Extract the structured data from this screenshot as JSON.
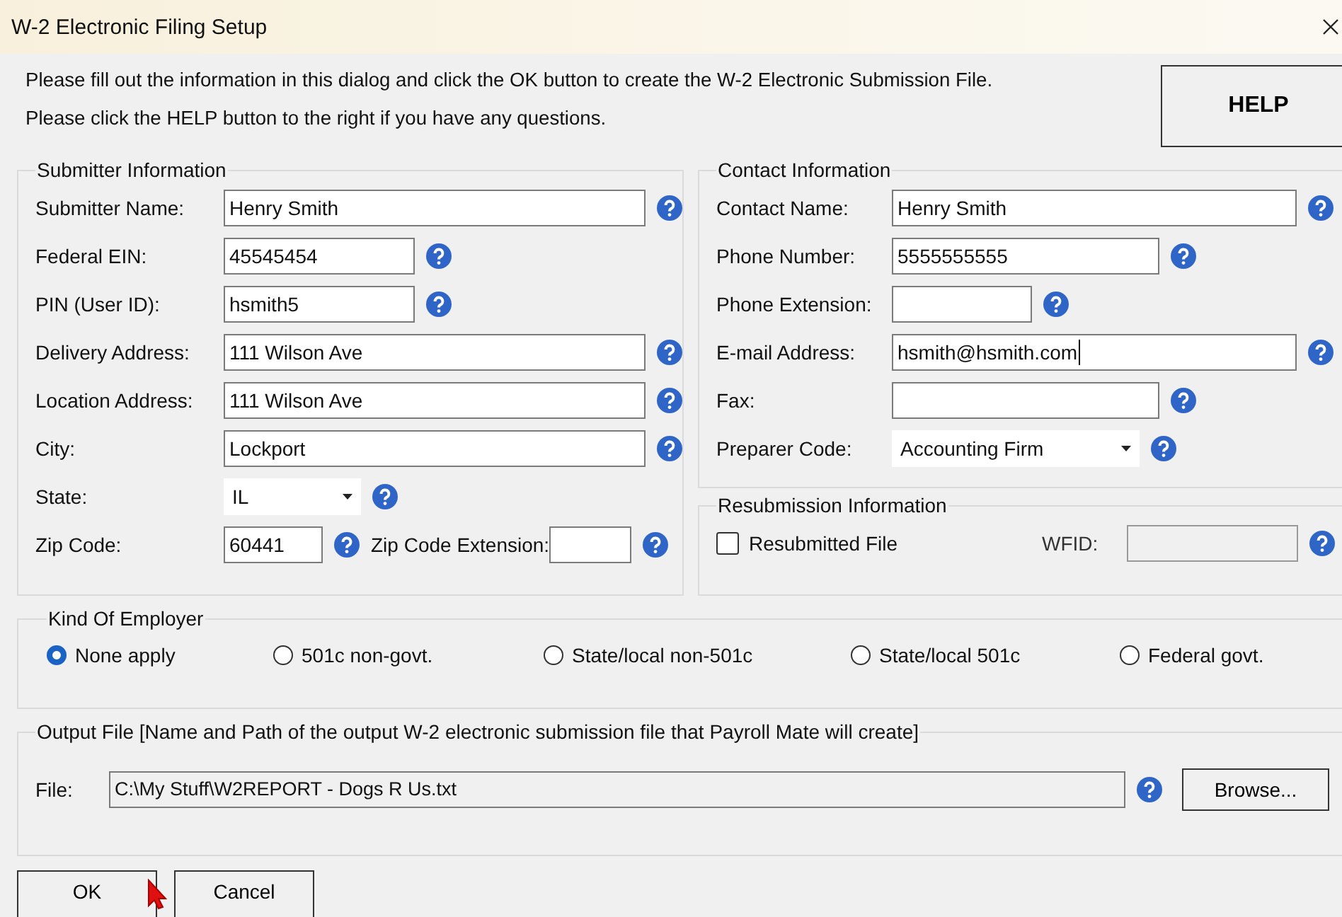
{
  "window": {
    "title": "W-2 Electronic Filing Setup"
  },
  "intro": [
    "Please fill out the information in this dialog and click the OK button to create the W-2 Electronic Submission File.",
    "Please click the HELP button to the right if you have any questions."
  ],
  "help_button": "HELP",
  "submitter": {
    "title": "Submitter Information",
    "rows": [
      {
        "label": "Submitter Name:",
        "value": "Henry Smith",
        "kind": "long"
      },
      {
        "label": "Federal EIN:",
        "value": "45545454",
        "kind": "short"
      },
      {
        "label": "PIN (User ID):",
        "value": "hsmith5",
        "kind": "short"
      },
      {
        "label": "Delivery Address:",
        "value": "111 Wilson Ave",
        "kind": "long"
      },
      {
        "label": "Location Address:",
        "value": "111 Wilson Ave",
        "kind": "long"
      },
      {
        "label": "City:",
        "value": "Lockport",
        "kind": "long"
      },
      {
        "label": "State:",
        "value": "IL",
        "kind": "select"
      },
      {
        "label": "Zip Code:",
        "value": "60441",
        "kind": "zip",
        "extension_label": "Zip Code Extension:"
      }
    ]
  },
  "contact": {
    "title": "Contact Information",
    "rows": [
      {
        "label": "Contact Name:",
        "value": "Henry Smith",
        "kind": "long"
      },
      {
        "label": "Phone Number:",
        "value": "5555555555",
        "kind": "medium"
      },
      {
        "label": "Phone Extension:",
        "kind": "short"
      },
      {
        "label": "E-mail Address:",
        "value": "hsmith@hsmith.com",
        "kind": "long",
        "focused": true
      },
      {
        "label": "Fax:",
        "kind": "medium"
      },
      {
        "label": "Preparer Code:",
        "value": "Accounting Firm",
        "kind": "select"
      }
    ]
  },
  "resubmission": {
    "title": "Resubmission Information",
    "checkbox": {
      "label": "Resubmitted File",
      "checked": false
    },
    "wfid_label": "WFID:",
    "wfid_disabled": true
  },
  "employer": {
    "title": "Kind Of Employer",
    "options": [
      {
        "label": "None apply",
        "selected": true
      },
      {
        "label": "501c non-govt.",
        "selected": false
      },
      {
        "label": "State/local non-501c",
        "selected": false
      },
      {
        "label": "State/local 501c",
        "selected": false
      },
      {
        "label": "Federal govt.",
        "selected": false
      }
    ]
  },
  "output": {
    "title": "Output File [Name and Path of the output W-2 electronic submission file that Payroll Mate will create]",
    "file_label": "File:",
    "path": "C:\\My Stuff\\W2REPORT - Dogs R Us.txt",
    "browse": "Browse..."
  },
  "buttons": [
    "OK",
    "Cancel"
  ]
}
